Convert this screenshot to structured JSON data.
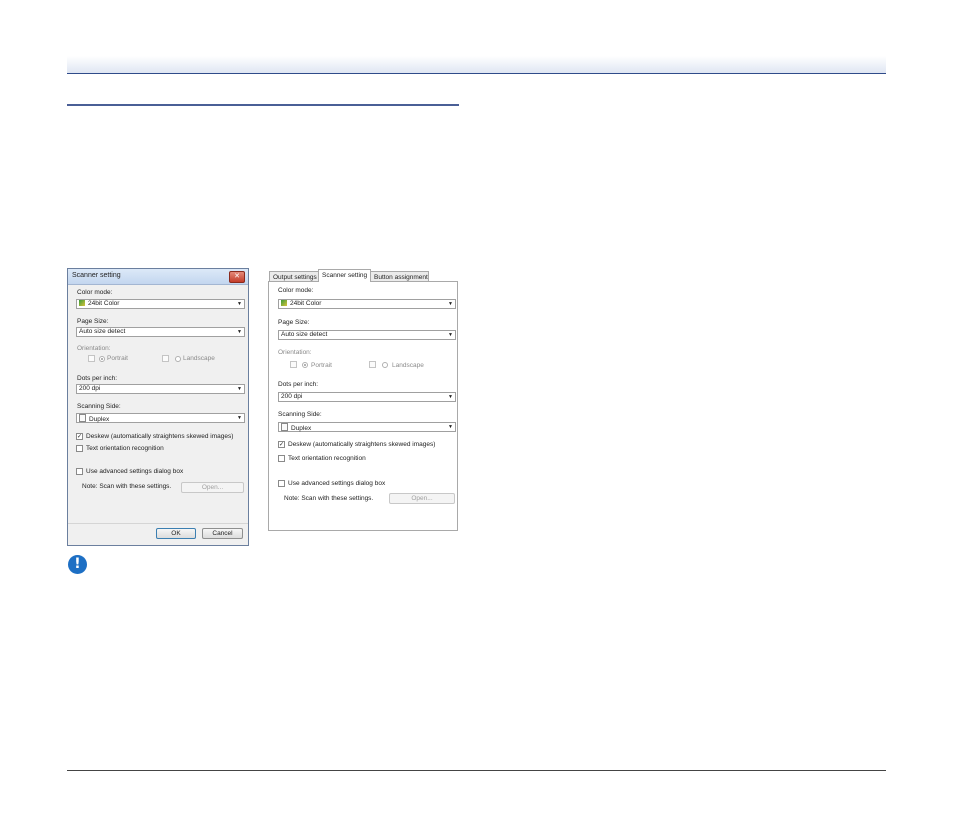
{
  "dialog": {
    "title": "Scanner setting",
    "color_mode_label": "Color mode:",
    "color_mode_value": "24bit Color",
    "page_size_label": "Page Size:",
    "page_size_value": "Auto size detect",
    "orientation_label": "Orientation:",
    "portrait_label": "Portrait",
    "landscape_label": "Landscape",
    "dpi_label": "Dots per inch:",
    "dpi_value": "200 dpi",
    "scanning_side_label": "Scanning Side:",
    "scanning_side_value": "Duplex",
    "deskew_label": "Deskew (automatically straightens skewed images)",
    "deskew_checked": true,
    "text_orientation_label": "Text orientation recognition",
    "text_orientation_checked": false,
    "advanced_label": "Use advanced settings dialog box",
    "advanced_checked": false,
    "note_label": "Note: Scan with these settings.",
    "open_button": "Open...",
    "ok_button": "OK",
    "cancel_button": "Cancel",
    "check_mark": "✓",
    "close_glyph": "✕"
  },
  "tabbed": {
    "tabs": [
      "Output settings",
      "Scanner setting",
      "Button assignment"
    ],
    "active_tab": "Scanner setting",
    "color_mode_label": "Color mode:",
    "color_mode_value": "24bit Color",
    "page_size_label": "Page Size:",
    "page_size_value": "Auto size detect",
    "orientation_label": "Orientation:",
    "portrait_label": "Portrait",
    "landscape_label": "Landscape",
    "dpi_label": "Dots per inch:",
    "dpi_value": "200 dpi",
    "scanning_side_label": "Scanning Side:",
    "scanning_side_value": "Duplex",
    "deskew_label": "Deskew (automatically straightens skewed images)",
    "deskew_checked": true,
    "text_orientation_label": "Text orientation recognition",
    "text_orientation_checked": false,
    "advanced_label": "Use advanced settings dialog box",
    "advanced_checked": false,
    "note_label": "Note: Scan with these settings.",
    "open_button": "Open..."
  },
  "icons": {
    "note": "important-note-icon",
    "note_glyph": "!"
  },
  "colors": {
    "header_rule": "#2f4b8a",
    "note_icon": "#1d6fc4"
  }
}
